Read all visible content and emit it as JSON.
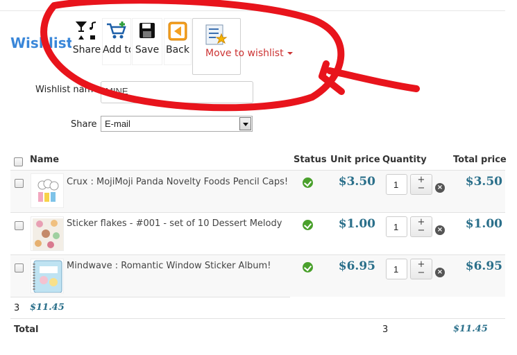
{
  "page": {
    "title": "Wishlist"
  },
  "toolbar": {
    "share_label": "Share",
    "add_label": "Add to cart",
    "save_label": "Save",
    "back_label": "Back",
    "move_label": "Move to wishlist",
    "icons": {
      "share": "share-icon",
      "add": "cart-add-icon",
      "save": "floppy-disk-icon",
      "back": "back-arrow-icon",
      "move": "list-star-icon"
    }
  },
  "form": {
    "name_label": "Wishlist name",
    "name_value": "MINE",
    "share_label": "Share",
    "share_value": "E-mail"
  },
  "table": {
    "headers": {
      "name": "Name",
      "status": "Status",
      "unit_price": "Unit price",
      "quantity": "Quantity",
      "total_price": "Total price"
    },
    "rows": [
      {
        "name": "Crux : MojiMoji Panda Novelty Foods Pencil Caps!",
        "unit_price": "$3.50",
        "quantity": "1",
        "total_price": "$3.50"
      },
      {
        "name": "Sticker flakes - #001 - set of 10 Dessert Melody",
        "unit_price": "$1.00",
        "quantity": "1",
        "total_price": "$1.00"
      },
      {
        "name": "Mindwave : Romantic Window Sticker Album!",
        "unit_price": "$6.95",
        "quantity": "1",
        "total_price": "$6.95"
      }
    ],
    "stepper": {
      "plus": "+",
      "minus": "−"
    },
    "remove_symbol": "×",
    "subtotal": {
      "count": "3",
      "amount": "$11.45"
    },
    "total": {
      "label": "Total",
      "count": "3",
      "amount": "$11.45"
    }
  },
  "colors": {
    "title": "#3a87d9",
    "price": "#2a6f8a",
    "move": "#cc3333",
    "status_ok": "#4aa02c",
    "annotation": "#e8141c"
  }
}
